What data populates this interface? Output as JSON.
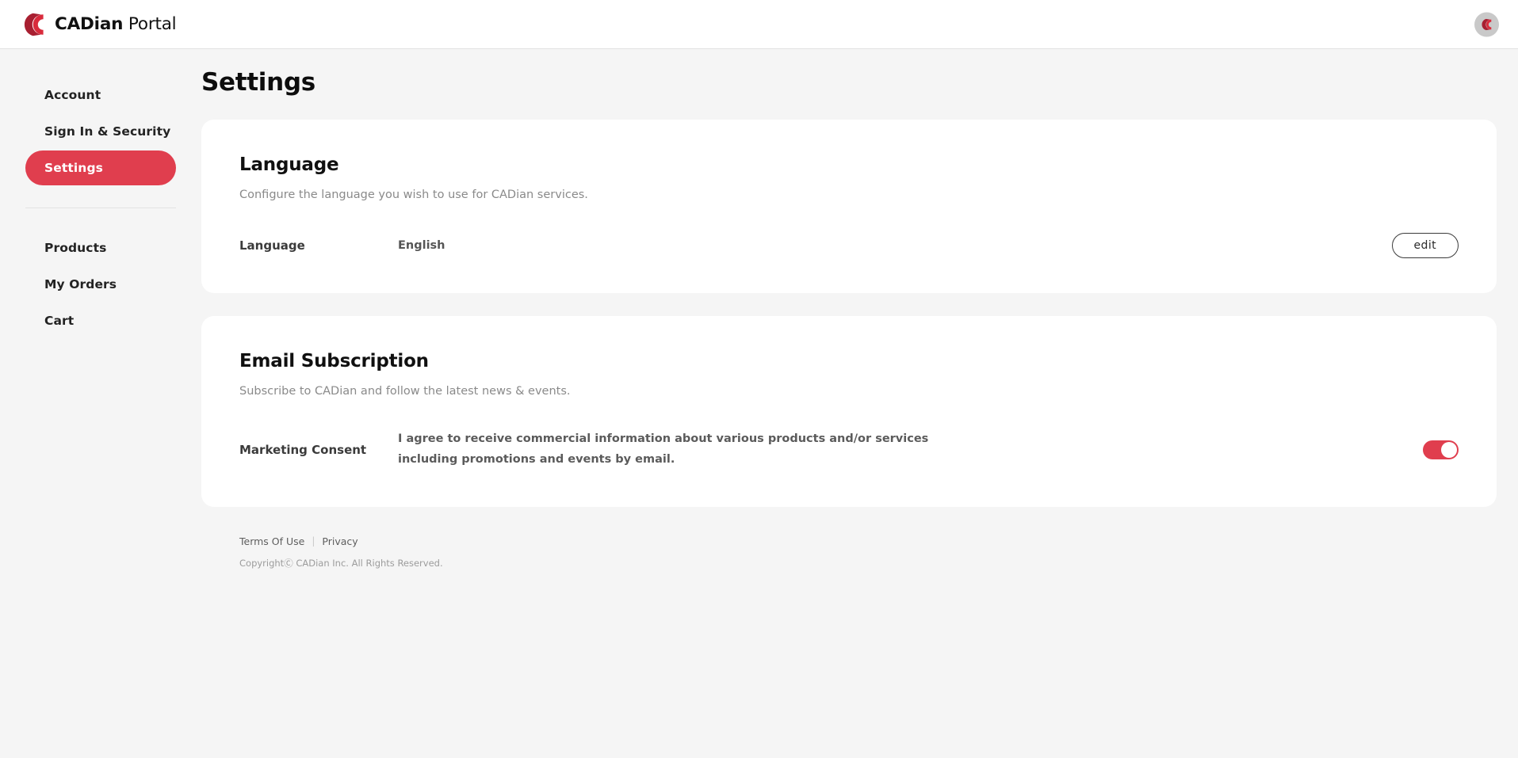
{
  "header": {
    "brand_bold": "CADian",
    "brand_light": " Portal",
    "logo_icon": "cadian-c-logo",
    "avatar_icon": "cadian-c-avatar"
  },
  "sidebar": {
    "primary": [
      {
        "label": "Account",
        "active": false
      },
      {
        "label": "Sign In & Security",
        "active": false
      },
      {
        "label": "Settings",
        "active": true
      }
    ],
    "secondary": [
      {
        "label": "Products",
        "active": false
      },
      {
        "label": "My Orders",
        "active": false
      },
      {
        "label": "Cart",
        "active": false
      }
    ]
  },
  "page": {
    "title": "Settings"
  },
  "language_card": {
    "title": "Language",
    "description": "Configure the language you wish to use for CADian services.",
    "row_label": "Language",
    "row_value": "English",
    "edit_label": "edit"
  },
  "email_card": {
    "title": "Email Subscription",
    "description": "Subscribe to CADian and follow the latest news & events.",
    "row_label": "Marketing Consent",
    "consent_text": "I agree to receive commercial information about various products and/or services including promotions and events by email.",
    "toggle_state": "on"
  },
  "footer": {
    "terms": "Terms Of Use",
    "separator": "|",
    "privacy": "Privacy",
    "copyright": "CopyrightⒸ CADian Inc. All Rights Reserved."
  },
  "colors": {
    "accent": "#e03e4e",
    "accent_dark": "#a81f31",
    "page_bg": "#f5f5f5",
    "card_bg": "#ffffff"
  }
}
